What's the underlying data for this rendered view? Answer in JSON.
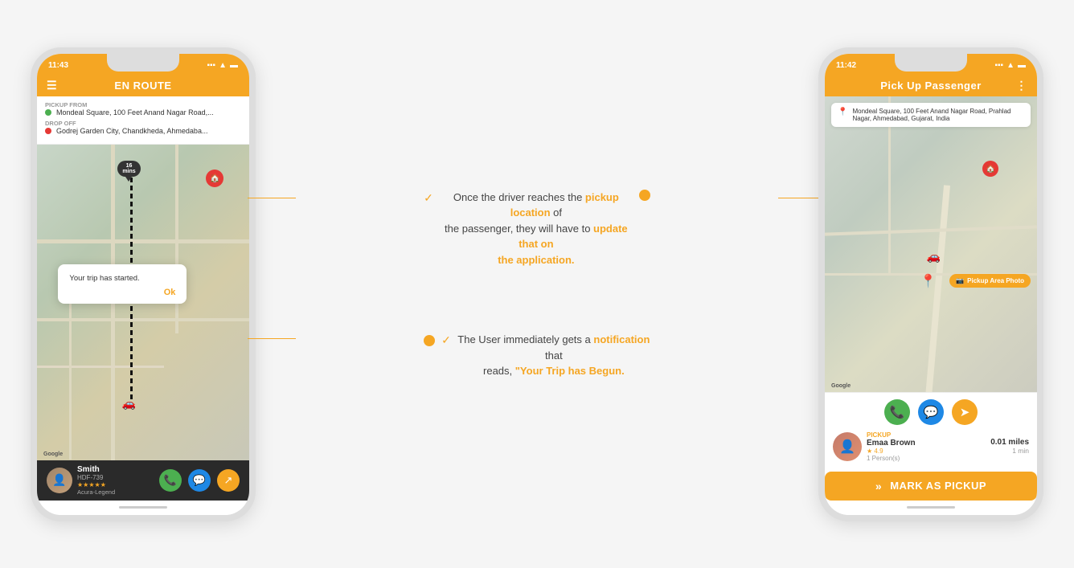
{
  "phone1": {
    "statusBar": {
      "time": "11:43",
      "timeIcon": "📍",
      "signal": "●●●",
      "wifi": "WiFi",
      "battery": "🔋"
    },
    "header": {
      "title": "EN ROUTE",
      "menuIcon": "☰"
    },
    "route": {
      "pickupLabel": "PICKUP FROM",
      "pickupAddress": "Mondeal Square, 100 Feet Anand Nagar Road,...",
      "dropoffLabel": "DROP OFF",
      "dropoffAddress": "Godrej Garden City, Chandkheda, Ahmedaba..."
    },
    "map": {
      "timeBubble": "16",
      "timeBubbleUnit": "mins"
    },
    "dialog": {
      "message": "Your trip has started.",
      "okLabel": "Ok"
    },
    "bottomBar": {
      "driverName": "Smith",
      "driverPlate": "HDF-739",
      "driverRating": "★★★★★",
      "driverCar": "Acura-Legend",
      "callIcon": "📞",
      "chatIcon": "💬",
      "shareIcon": "↗"
    }
  },
  "phone2": {
    "statusBar": {
      "time": "11:42",
      "signal": "●●●",
      "wifi": "WiFi",
      "battery": "🔋"
    },
    "header": {
      "title": "Pick Up Passenger",
      "moreIcon": "⋮"
    },
    "pickupLocation": {
      "address": "Mondeal Square, 100 Feet Anand Nagar Road, Prahlad Nagar, Ahmedabad, Gujarat, India"
    },
    "pickupAreaBtn": "Pickup Area Photo",
    "passengerPanel": {
      "pickupLabel": "PICKUP",
      "passengerName": "Emaa Brown",
      "rating": "★ 4.9",
      "persons": "1 Person(s)",
      "distance": "0.01 miles",
      "time": "1 min",
      "callIcon": "📞",
      "chatIcon": "💬",
      "navIcon": "➤"
    },
    "markPickupBtn": {
      "arrows": "»",
      "label": "MARK AS PICKUP"
    }
  },
  "annotations": {
    "top": {
      "text1": "Once the driver reaches the pickup location of",
      "text2": "the passenger, they will have to update that on",
      "text3": "the application."
    },
    "bottom": {
      "text1": "The User immediately gets a notification that",
      "text2": "reads, \"Your Trip has Begun."
    }
  }
}
